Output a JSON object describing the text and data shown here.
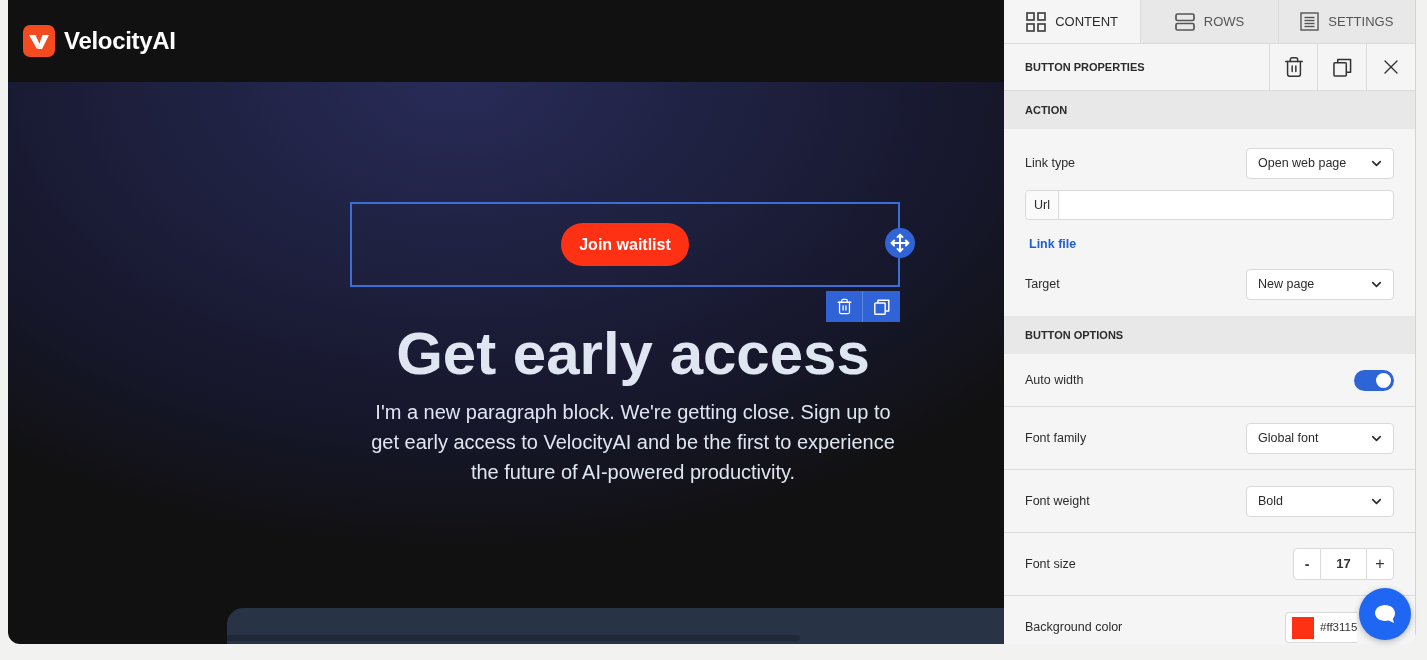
{
  "brand": {
    "name": "VelocityAI"
  },
  "canvas": {
    "block": {
      "selected": true,
      "button": "Join waitlist"
    },
    "heading": "Get early access",
    "paragraph": "I'm a new paragraph block. We're getting close. Sign up to get early access to VelocityAI and be the first to experience the future of AI-powered productivity."
  },
  "panel": {
    "tabs": [
      {
        "label": "CONTENT",
        "selected": true
      },
      {
        "label": "ROWS",
        "selected": false
      },
      {
        "label": "SETTINGS",
        "selected": false
      }
    ],
    "title": "BUTTON PROPERTIES",
    "sections": [
      {
        "title": "ACTION",
        "fields": [
          {
            "kind": "select",
            "label": "Link type",
            "value": "Open web page"
          },
          {
            "kind": "url",
            "prefix": "Url"
          },
          {
            "kind": "link",
            "label": "Link file"
          },
          {
            "kind": "select",
            "label": "Target",
            "value": "New page"
          }
        ]
      },
      {
        "title": "BUTTON OPTIONS",
        "fields": [
          {
            "kind": "toggle",
            "label": "Auto width",
            "on": true
          },
          {
            "kind": "select",
            "label": "Font family",
            "value": "Global font"
          },
          {
            "kind": "select",
            "label": "Font weight",
            "value": "Bold"
          },
          {
            "kind": "stepper",
            "label": "Font size",
            "decrement": "-",
            "value": "17",
            "increment": "+"
          },
          {
            "kind": "color",
            "label": "Background color",
            "value": "#ff3115",
            "color": "#ff3115"
          }
        ]
      }
    ]
  }
}
